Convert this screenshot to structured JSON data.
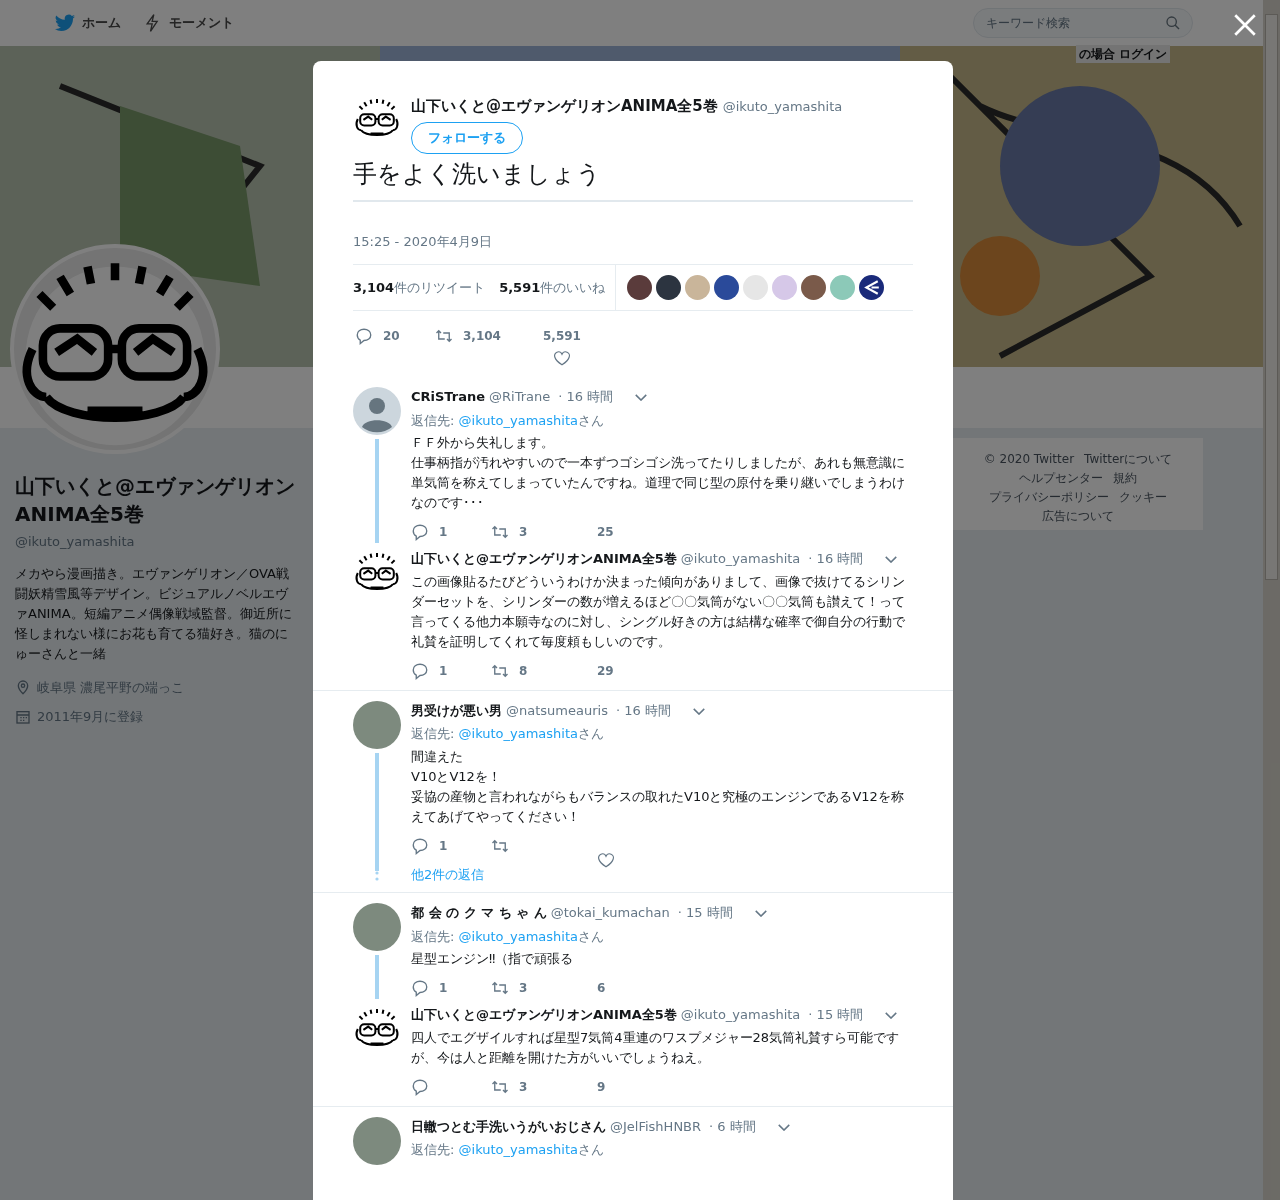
{
  "top_nav": {
    "items": [
      {
        "label": "ホーム"
      },
      {
        "label": "モーメント"
      }
    ],
    "search": {
      "placeholder": "キーワード検索"
    },
    "login_hint": "の場合 ログイン"
  },
  "profile": {
    "name": "山下いくと@エヴァンゲリオンANIMA全5巻",
    "handle": "@ikuto_yamashita",
    "bio": "メカやら漫画描き。エヴァンゲリオン／OVA戦闘妖精雪風等デザイン。ビジュアルノベルエヴァANIMA。短編アニメ偶像戦域監督。御近所に怪しまれない様にお花も育てる猫好き。猫のにゅーさんと一緒",
    "location": "岐阜県 濃尾平野の端っこ",
    "joined": "2011年9月に登録"
  },
  "footer_links": [
    "© 2020 Twitter",
    "Twitterについて",
    "ヘルプセンター",
    "規約",
    "プライバシーポリシー",
    "クッキー",
    "広告について"
  ],
  "tweet": {
    "name": "山下いくと@エヴァンゲリオンANIMA全5巻",
    "handle": "@ikuto_yamashita",
    "follow_button": "フォローする",
    "text": "手をよく洗いましょう",
    "timestamp": "15:25 - 2020年4月9日",
    "retweet_count": "3,104",
    "retweet_label": "件のリツイート",
    "like_count": "5,591",
    "like_label": "件のいいね",
    "likers": [
      {
        "kind": "photo"
      },
      {
        "kind": "photo"
      },
      {
        "kind": "photo"
      },
      {
        "kind": "photo"
      },
      {
        "kind": "photo"
      },
      {
        "kind": "photo"
      },
      {
        "kind": "photo"
      },
      {
        "kind": "photo"
      },
      {
        "kind": "logo"
      }
    ],
    "actions": {
      "replies": "20",
      "retweets": "3,104",
      "likes": "5,591",
      "like_icon": true
    }
  },
  "threads": [
    {
      "tweets": [
        {
          "kind": "default",
          "name": "CRiSTrane",
          "handle": "@RiTrane",
          "time": "· 16 時間",
          "reply_label": "返信先: ",
          "reply_to": "@ikuto_yamashita",
          "reply_suffix": "さん",
          "lines": [
            "ＦＦ外から失礼します。",
            "仕事柄指が汚れやすいので一本ずつゴシゴシ洗ってたりしましたが、あれも無意識に単気筒を称えてしまっていたんですね。道理で同じ型の原付を乗り継いでしまうわけなのです･･･"
          ],
          "replies": "1",
          "retweets": "3",
          "likes": "25",
          "like_icon": false
        },
        {
          "kind": "author",
          "name": "山下いくと@エヴァンゲリオンANIMA全5巻",
          "handle": "@ikuto_yamashita",
          "time": "· 16 時間",
          "lines": [
            "この画像貼るたびどういうわけか決まった傾向がありまして、画像で抜けてるシリンダーセットを、シリンダーの数が増えるほど〇〇気筒がない〇〇気筒も讃えて！って言ってくる他力本願寺なのに対し、シングル好きの方は結構な確率で御自分の行動で礼賛を証明してくれて毎度頼もしいのです。"
          ],
          "replies": "1",
          "retweets": "8",
          "likes": "29",
          "like_icon": false
        }
      ]
    },
    {
      "tweets": [
        {
          "kind": "photo",
          "name": "男受けが悪い男",
          "handle": "@natsumeauris",
          "time": "· 16 時間",
          "reply_label": "返信先: ",
          "reply_to": "@ikuto_yamashita",
          "reply_suffix": "さん",
          "lines": [
            "間違えた",
            "V10とV12を！",
            "妥協の産物と言われながらもバランスの取れたV10と究極のエンジンであるV12を称えてあげてやってください！"
          ],
          "replies": "1",
          "like_icon": true
        }
      ],
      "more_replies": "他2件の返信"
    },
    {
      "tweets": [
        {
          "kind": "photo",
          "name": "都 会 の ク マ ち ゃ ん",
          "handle": "@tokai_kumachan",
          "time": "· 15 時間",
          "reply_label": "返信先: ",
          "reply_to": "@ikuto_yamashita",
          "reply_suffix": "さん",
          "lines": [
            "星型エンジン‼（指で頑張る"
          ],
          "replies": "1",
          "retweets": "3",
          "likes": "6",
          "like_icon": false
        },
        {
          "kind": "author",
          "name": "山下いくと@エヴァンゲリオンANIMA全5巻",
          "handle": "@ikuto_yamashita",
          "time": "· 15 時間",
          "lines": [
            "四人でエグザイルすれば星型7気筒4重連のワスプメジャー28気筒礼賛すら可能ですが、今は人と距離を開けた方がいいでしょうねえ。"
          ],
          "retweets": "3",
          "likes": "9",
          "like_icon": false
        }
      ]
    },
    {
      "tweets": [
        {
          "kind": "photo",
          "name": "日轍つとむ手洗いうがいおじさん",
          "handle": "@JelFishHNBR",
          "time": "· 6 時間",
          "reply_label": "返信先: ",
          "reply_to": "@ikuto_yamashita",
          "reply_suffix": "さん"
        }
      ]
    }
  ]
}
